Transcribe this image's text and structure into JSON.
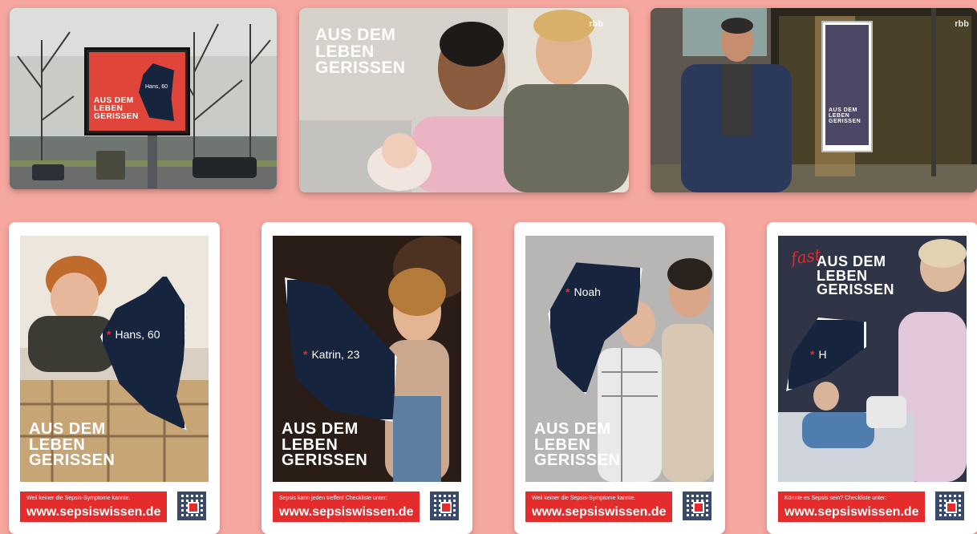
{
  "photos": [
    {
      "name": "billboard-street-photo",
      "billboard": {
        "headline": [
          "AUS DEM",
          "LEBEN",
          "GERISSEN"
        ],
        "label": "Hans, 60"
      }
    },
    {
      "name": "couple-with-baby-tv-still",
      "headline": [
        "AUS DEM",
        "LEBEN",
        "GERISSEN"
      ],
      "channel_logo": "rbb"
    },
    {
      "name": "presenter-at-bus-stop-tv-still",
      "channel_logo": "rbb",
      "poster_headline": [
        "AUS DEM",
        "LEBEN",
        "GERISSEN"
      ]
    }
  ],
  "posters": [
    {
      "label": "Hans, 60",
      "headline": [
        "AUS DEM",
        "LEBEN",
        "GERISSEN"
      ],
      "footer_small": "Weil keiner die Sepsis-Symptome kannte.",
      "url": "www.sepsiswissen.de"
    },
    {
      "label": "Katrin, 23",
      "headline": [
        "AUS DEM",
        "LEBEN",
        "GERISSEN"
      ],
      "footer_small": "Sepsis kann jeden treffen! Checkliste unter:",
      "url": "www.sepsiswissen.de"
    },
    {
      "label": "Noah",
      "headline": [
        "AUS DEM",
        "LEBEN",
        "GERISSEN"
      ],
      "footer_small": "Weil keiner die Sepsis-Symptome kannte.",
      "url": "www.sepsiswissen.de"
    },
    {
      "label": "H",
      "fast": "fast",
      "headline": [
        "AUS DEM",
        "LEBEN",
        "GERISSEN"
      ],
      "footer_small": "Könnte es Sepsis sein? Checkliste unter:",
      "url": "www.sepsiswissen.de"
    }
  ],
  "colors": {
    "background": "#f6a8a0",
    "brand_red": "#e32c2b",
    "tear_navy": "#16253d"
  }
}
